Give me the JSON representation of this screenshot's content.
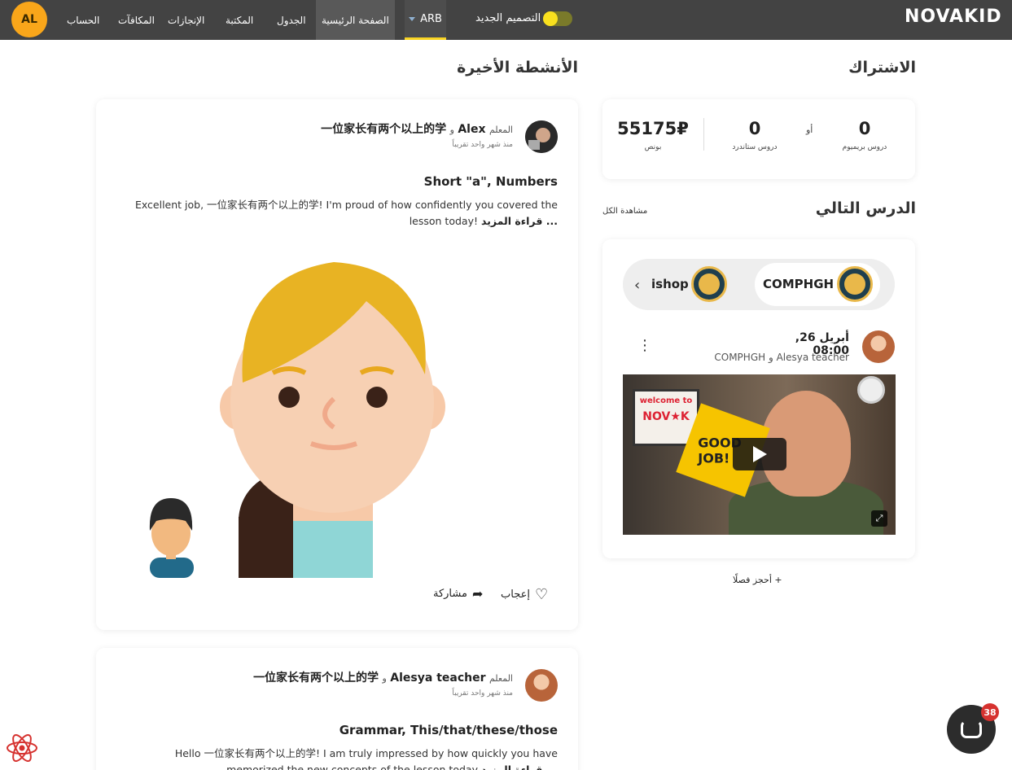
{
  "header": {
    "avatar_initials": "AL",
    "nav": [
      "الحساب",
      "المكافآت",
      "الإنجازات",
      "المكتبة",
      "الجدول",
      "الصفحة الرئيسية"
    ],
    "active_nav": "الصفحة الرئيسية",
    "language": "ARB",
    "new_design_label": "التصميم الجديد",
    "logo": "NOVAKID"
  },
  "subscription": {
    "title": "الاشتراك",
    "premium_lessons": {
      "value": "0",
      "label": "دروس بريميوم"
    },
    "or_label": "أو",
    "standard_lessons": {
      "value": "0",
      "label": "دروس ستاندرد"
    },
    "bonus": {
      "value": "55175₽",
      "label": "بونص"
    }
  },
  "next_lesson": {
    "title": "الدرس التالي",
    "see_all": "مشاهدة الكل",
    "courses": [
      "COMPHGH",
      "ishop"
    ],
    "date": "أبريل 26, 08:00",
    "participants": "Alesya teacher و COMPHGH",
    "book_class": "+ أحجز فصلًا"
  },
  "activities": {
    "title": "الأنشطة الأخيرة",
    "items": [
      {
        "teacher_prefix": "المعلم",
        "teacher": "Alex",
        "connector": "و",
        "student": "一位家长有两个以上的学",
        "time": "منذ شهر واحد تقريباً",
        "lesson": "Short \"a\", Numbers",
        "text_line1": "Excellent job, 一位家长有两个以上的学! I'm proud of how confidently you covered the",
        "text_line2": "lesson today!",
        "read_more": "قراءة المزيد ...",
        "like": "إعجاب",
        "share": "مشاركة"
      },
      {
        "teacher_prefix": "المعلم",
        "teacher": "Alesya teacher",
        "connector": "و",
        "student": "一位家长有两个以上的学",
        "time": "منذ شهر واحد تقريباً",
        "lesson": "Grammar, This/that/these/those",
        "text_line1": "Hello 一位家长有两个以上的学! I am truly impressed by how quickly you have",
        "text_line2": "memorized the new concepts of the lesson today",
        "read_more": "قراءة المزيد ..."
      }
    ]
  },
  "video": {
    "sign_line1": "welcome to",
    "sign_line2": "NOV★K",
    "burst_text": "GOOD JOB!"
  },
  "chat": {
    "unread": "38"
  },
  "colors": {
    "accent": "#f9d423",
    "avatar": "#f9a61a",
    "topbar": "#434343",
    "badge": "#d6322f"
  }
}
